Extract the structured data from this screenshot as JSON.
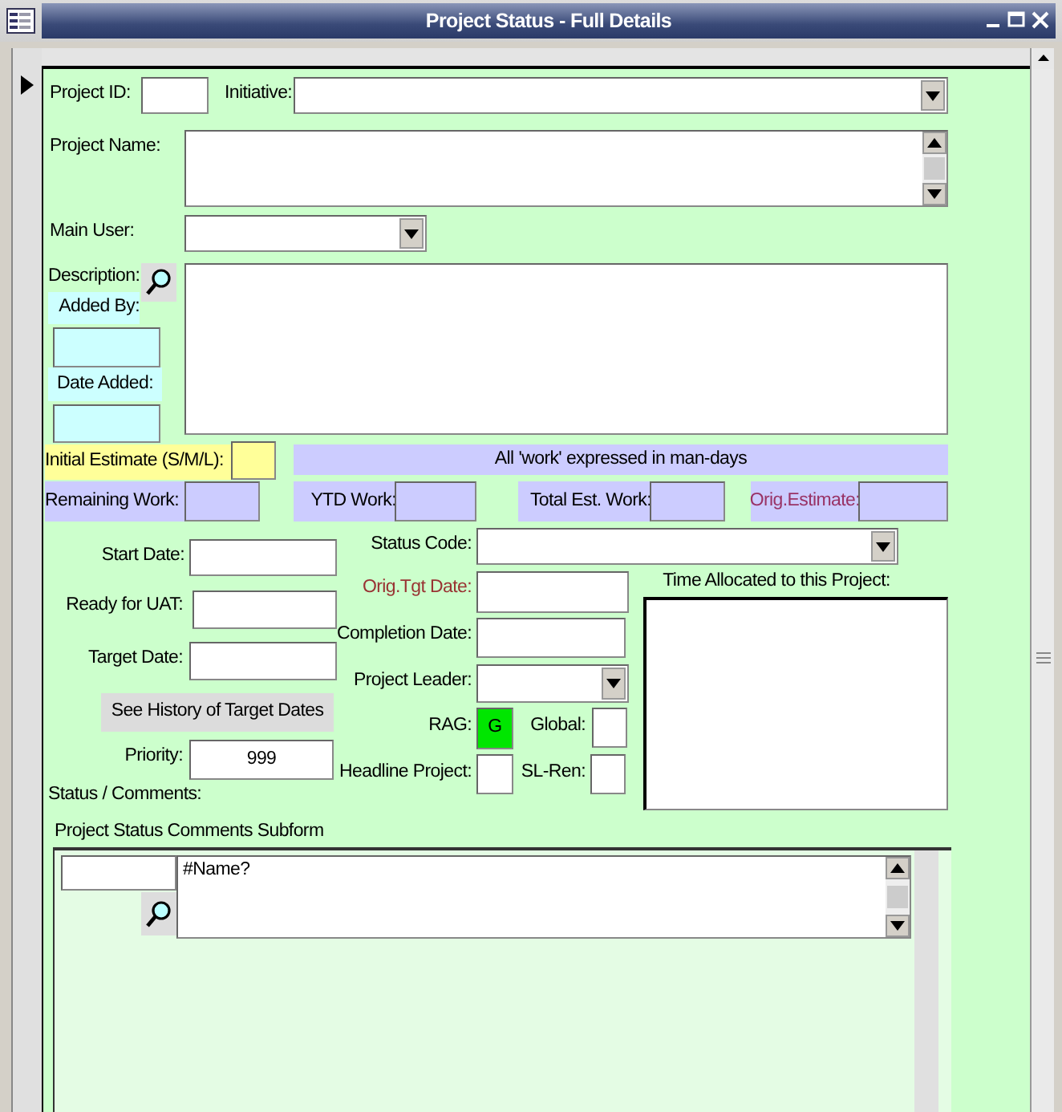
{
  "window": {
    "title": "Project Status - Full Details"
  },
  "fields": [
    {
      "label": "Project ID:",
      "kind": "text"
    },
    {
      "label": "Initiative:",
      "kind": "combo"
    },
    {
      "label": "Project Name:",
      "kind": "memo_scroll"
    },
    {
      "label": "Main User:",
      "kind": "combo"
    },
    {
      "label": "Description:",
      "kind": "zoom_memo"
    },
    {
      "label": "Added By:",
      "kind": "text"
    },
    {
      "label": "Date Added:",
      "kind": "text"
    },
    {
      "label": "Initial Estimate (S/M/L):",
      "kind": "text"
    },
    {
      "label": "All 'work' expressed in man-days",
      "kind": "banner"
    },
    {
      "label": "Remaining Work:",
      "kind": "text"
    },
    {
      "label": "YTD Work:",
      "kind": "text"
    },
    {
      "label": "Total Est. Work:",
      "kind": "text"
    },
    {
      "label": "Orig.Estimate:",
      "kind": "text"
    },
    {
      "label": "Start Date:",
      "kind": "text"
    },
    {
      "label": "Status Code:",
      "kind": "combo"
    },
    {
      "label": "Orig.Tgt Date:",
      "kind": "text"
    },
    {
      "label": "Completion Date:",
      "kind": "text"
    },
    {
      "label": "Ready for UAT:",
      "kind": "text"
    },
    {
      "label": "Target Date:",
      "kind": "text"
    },
    {
      "label": "Project Leader:",
      "kind": "combo"
    },
    {
      "label": "See History of Target Dates",
      "kind": "button"
    },
    {
      "label": "RAG:",
      "kind": "text",
      "value": "G",
      "color": "#00e600"
    },
    {
      "label": "Global:",
      "kind": "text"
    },
    {
      "label": "Priority:",
      "kind": "text",
      "value": "999"
    },
    {
      "label": "Headline Project:",
      "kind": "text"
    },
    {
      "label": "SL-Ren:",
      "kind": "text"
    },
    {
      "label": "Time Allocated to this Project:",
      "kind": "box"
    },
    {
      "label": "Status / Comments:",
      "kind": "caption"
    }
  ],
  "subform": {
    "label": "Project Status Comments Subform",
    "rows": [
      {
        "comment": "#Name?"
      }
    ]
  }
}
